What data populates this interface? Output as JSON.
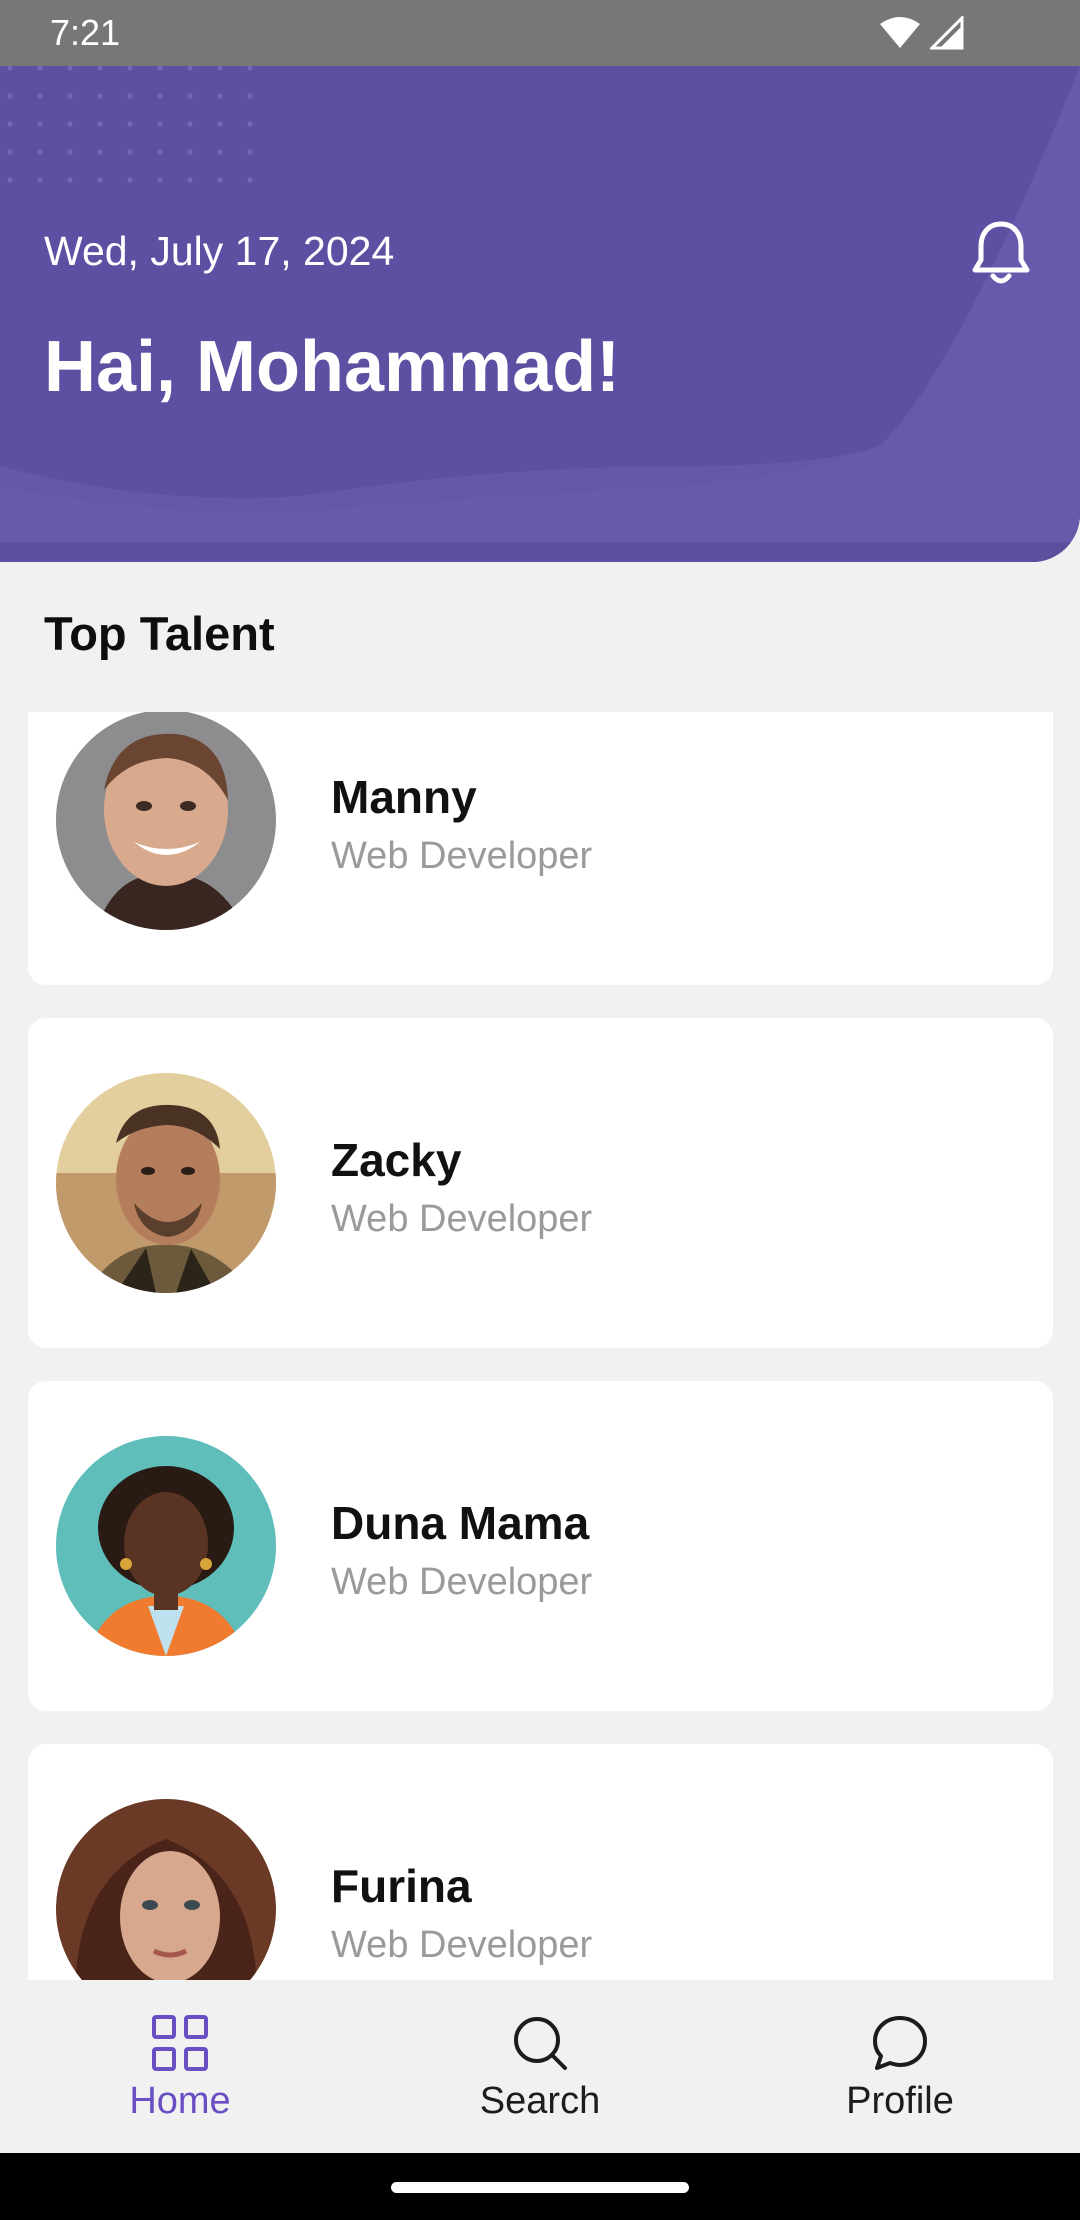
{
  "status_bar": {
    "time": "7:21",
    "icons": [
      "wifi-icon",
      "signal-icon"
    ]
  },
  "header": {
    "date": "Wed, July 17, 2024",
    "greeting": "Hai, Mohammad!",
    "bell_icon": "bell-icon",
    "background_color": "#5d50a2"
  },
  "section": {
    "title": "Top Talent"
  },
  "talents": [
    {
      "name": "Manny",
      "role": "Web Developer"
    },
    {
      "name": "Zacky",
      "role": "Web Developer"
    },
    {
      "name": "Duna Mama",
      "role": "Web Developer"
    },
    {
      "name": "Furina",
      "role": "Web Developer"
    }
  ],
  "bottom_nav": {
    "items": [
      {
        "label": "Home",
        "icon": "grid-icon",
        "active": true
      },
      {
        "label": "Search",
        "icon": "search-icon",
        "active": false
      },
      {
        "label": "Profile",
        "icon": "chat-bubble-icon",
        "active": false
      }
    ],
    "active_color": "#6a4fc4"
  }
}
